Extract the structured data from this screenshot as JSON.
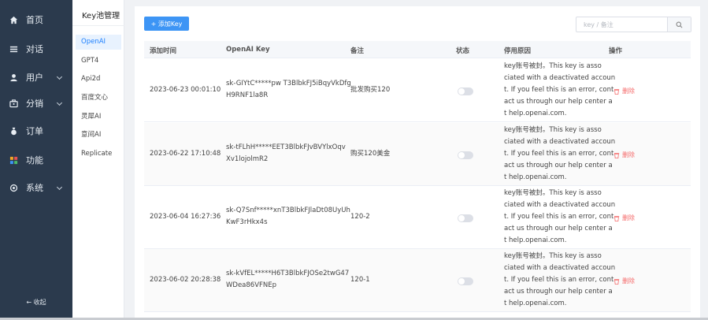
{
  "sidebar": {
    "items": [
      {
        "label": "首页",
        "icon": "home-icon",
        "has_arrow": false
      },
      {
        "label": "对话",
        "icon": "list-icon",
        "has_arrow": false
      },
      {
        "label": "用户",
        "icon": "user-icon",
        "has_arrow": true
      },
      {
        "label": "分销",
        "icon": "share-icon",
        "has_arrow": true
      },
      {
        "label": "订单",
        "icon": "bag-icon",
        "has_arrow": false
      },
      {
        "label": "功能",
        "icon": "grid-icon",
        "has_arrow": false
      },
      {
        "label": "系统",
        "icon": "settings-icon",
        "has_arrow": true
      }
    ],
    "collapse_label": "← 收起"
  },
  "submenu": {
    "title": "Key池管理",
    "items": [
      "OpenAI",
      "GPT4",
      "Api2d",
      "百度文心",
      "灵犀AI",
      "意间AI",
      "Replicate"
    ],
    "active": "OpenAI"
  },
  "toolbar": {
    "add_label": "+ 添加Key",
    "search_placeholder": "key / 备注"
  },
  "table": {
    "columns": [
      "添加时间",
      "OpenAI Key",
      "备注",
      "状态",
      "停用原因",
      "操作"
    ],
    "rows": [
      {
        "time": "2023-06-23 00:01:10",
        "key1": "sk-GIYtC*****pw T3BlbkFJ5iBqyVkDfg",
        "key2": "H9RNF1la8R",
        "note": "批发购买120",
        "enabled": false,
        "reason": [
          "key账号被封。This key is asso",
          "ciated with a deactivated accoun",
          "t. If you feel this is an error, cont",
          "act us through our help center a",
          "t help.openai.com."
        ],
        "action": "删除"
      },
      {
        "time": "2023-06-22 17:10:48",
        "key1": "sk-tFLhH*****EET3BlbkFJvBVYlxOqv",
        "key2": "Xv1lojolmR2",
        "note": "购买120美金",
        "enabled": false,
        "reason": [
          "key账号被封。This key is asso",
          "ciated with a deactivated accoun",
          "t. If you feel this is an error, cont",
          "act us through our help center a",
          "t help.openai.com."
        ],
        "action": "删除"
      },
      {
        "time": "2023-06-04 16:27:36",
        "key1": "sk-Q7Snf*****xnT3BlbkFJlaDt08UyUh",
        "key2": "KwF3rHkx4s",
        "note": "120-2",
        "enabled": false,
        "reason": [
          "key账号被封。This key is asso",
          "ciated with a deactivated accoun",
          "t. If you feel this is an error, cont",
          "act us through our help center a",
          "t help.openai.com."
        ],
        "action": "删除"
      },
      {
        "time": "2023-06-02 20:28:38",
        "key1": "sk-kVfEL*****H6T3BlbkFJOSe2twG47",
        "key2": "WDea86VFNEp",
        "note": "120-1",
        "enabled": false,
        "reason": [
          "key账号被封。This key is asso",
          "ciated with a deactivated accoun",
          "t. If you feel this is an error, cont",
          "act us through our help center a",
          "t help.openai.com."
        ],
        "action": "删除"
      }
    ]
  },
  "colors": {
    "sidebar_bg": "#2b3a4d",
    "accent": "#3d95f5",
    "danger": "#f56c6c"
  }
}
